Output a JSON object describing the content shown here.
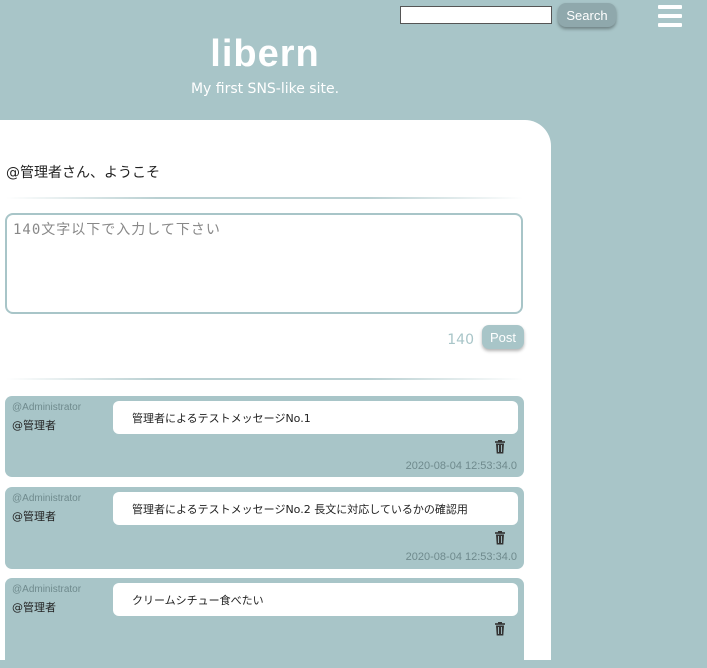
{
  "header": {
    "search_placeholder": "",
    "search_label": "Search",
    "logo": "libern",
    "tagline": "My first SNS-like site."
  },
  "main": {
    "welcome": "@管理者さん、ようこそ",
    "post_placeholder": "140文字以下で入力して下さい",
    "char_count": "140",
    "post_label": "Post"
  },
  "messages": [
    {
      "handle": "@Administrator",
      "name": "@管理者",
      "text": "管理者によるテストメッセージNo.1",
      "time": "2020-08-04 12:53:34.0"
    },
    {
      "handle": "@Administrator",
      "name": "@管理者",
      "text": "管理者によるテストメッセージNo.2 長文に対応しているかの確認用",
      "time": "2020-08-04 12:53:34.0"
    },
    {
      "handle": "@Administrator",
      "name": "@管理者",
      "text": "クリームシチュー食べたい",
      "time": ""
    }
  ],
  "icons": {
    "menu": "hamburger-menu-icon",
    "delete": "trash-icon"
  },
  "colors": {
    "background": "#a8c5c8",
    "card": "#ffffff",
    "button": "#8fa8ac"
  }
}
